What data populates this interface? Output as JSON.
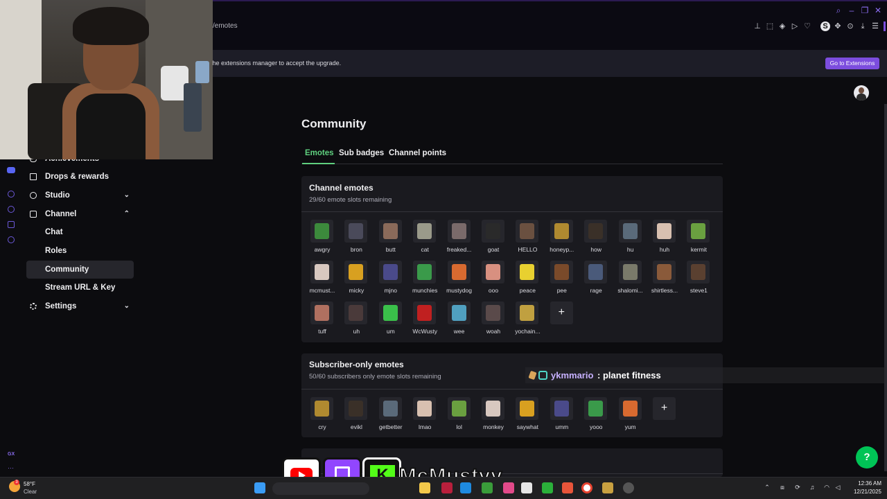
{
  "browser": {
    "url_fragment": "/emotes",
    "banner_text": "the extensions manager to accept the upgrade.",
    "go_extensions": "Go to Extensions",
    "gx_label": "GX"
  },
  "sidebar": {
    "items": [
      {
        "label": "Achievements",
        "icon": "trophy-icon"
      },
      {
        "label": "Drops & rewards",
        "icon": "gift-icon"
      },
      {
        "label": "Studio",
        "icon": "camera-icon"
      },
      {
        "label": "Channel",
        "icon": "channel-icon"
      },
      {
        "label": "Settings",
        "icon": "gear-icon"
      }
    ],
    "channel_sub": [
      "Chat",
      "Roles",
      "Community",
      "Stream URL & Key"
    ],
    "active_sub": "Community"
  },
  "main": {
    "title": "Community",
    "tabs": [
      {
        "label": "Emotes",
        "active": true
      },
      {
        "label": "Sub badges",
        "active": false
      },
      {
        "label": "Channel points",
        "active": false
      }
    ],
    "channel_emotes": {
      "title": "Channel emotes",
      "subtitle": "29/60 emote slots remaining",
      "emotes": [
        "awgry",
        "bron",
        "butt",
        "cat",
        "freaked...",
        "goat",
        "HELLO",
        "honeyp...",
        "how",
        "hu",
        "huh",
        "kermit",
        "mcmust...",
        "micky",
        "mjno",
        "munchies",
        "mustydog",
        "ooo",
        "peace",
        "pee",
        "rage",
        "shalomi...",
        "shirtless...",
        "steve1",
        "tuff",
        "uh",
        "um",
        "WcWusty",
        "wee",
        "woah",
        "yochain..."
      ],
      "add_label": "+"
    },
    "sub_emotes": {
      "title": "Subscriber-only emotes",
      "subtitle": "50/60 subscribers only emote slots remaining",
      "emotes": [
        "cry",
        "evikl",
        "getbetter",
        "lmao",
        "lol",
        "monkey",
        "saywhat",
        "umm",
        "yooo",
        "yum"
      ],
      "add_label": "+"
    }
  },
  "overlay": {
    "chat_user": "ykmmario",
    "chat_message": ": planet fitness",
    "social_name": "McMustyy"
  },
  "taskbar": {
    "temp": "58°F",
    "weather": "Clear",
    "time": "12:36 AM",
    "date": "12/21/2025"
  },
  "colors": {
    "accent": "#7c4dde",
    "tab_underline": "#5fd07f",
    "help": "#00c456",
    "chat_user": "#c7b1ff"
  }
}
